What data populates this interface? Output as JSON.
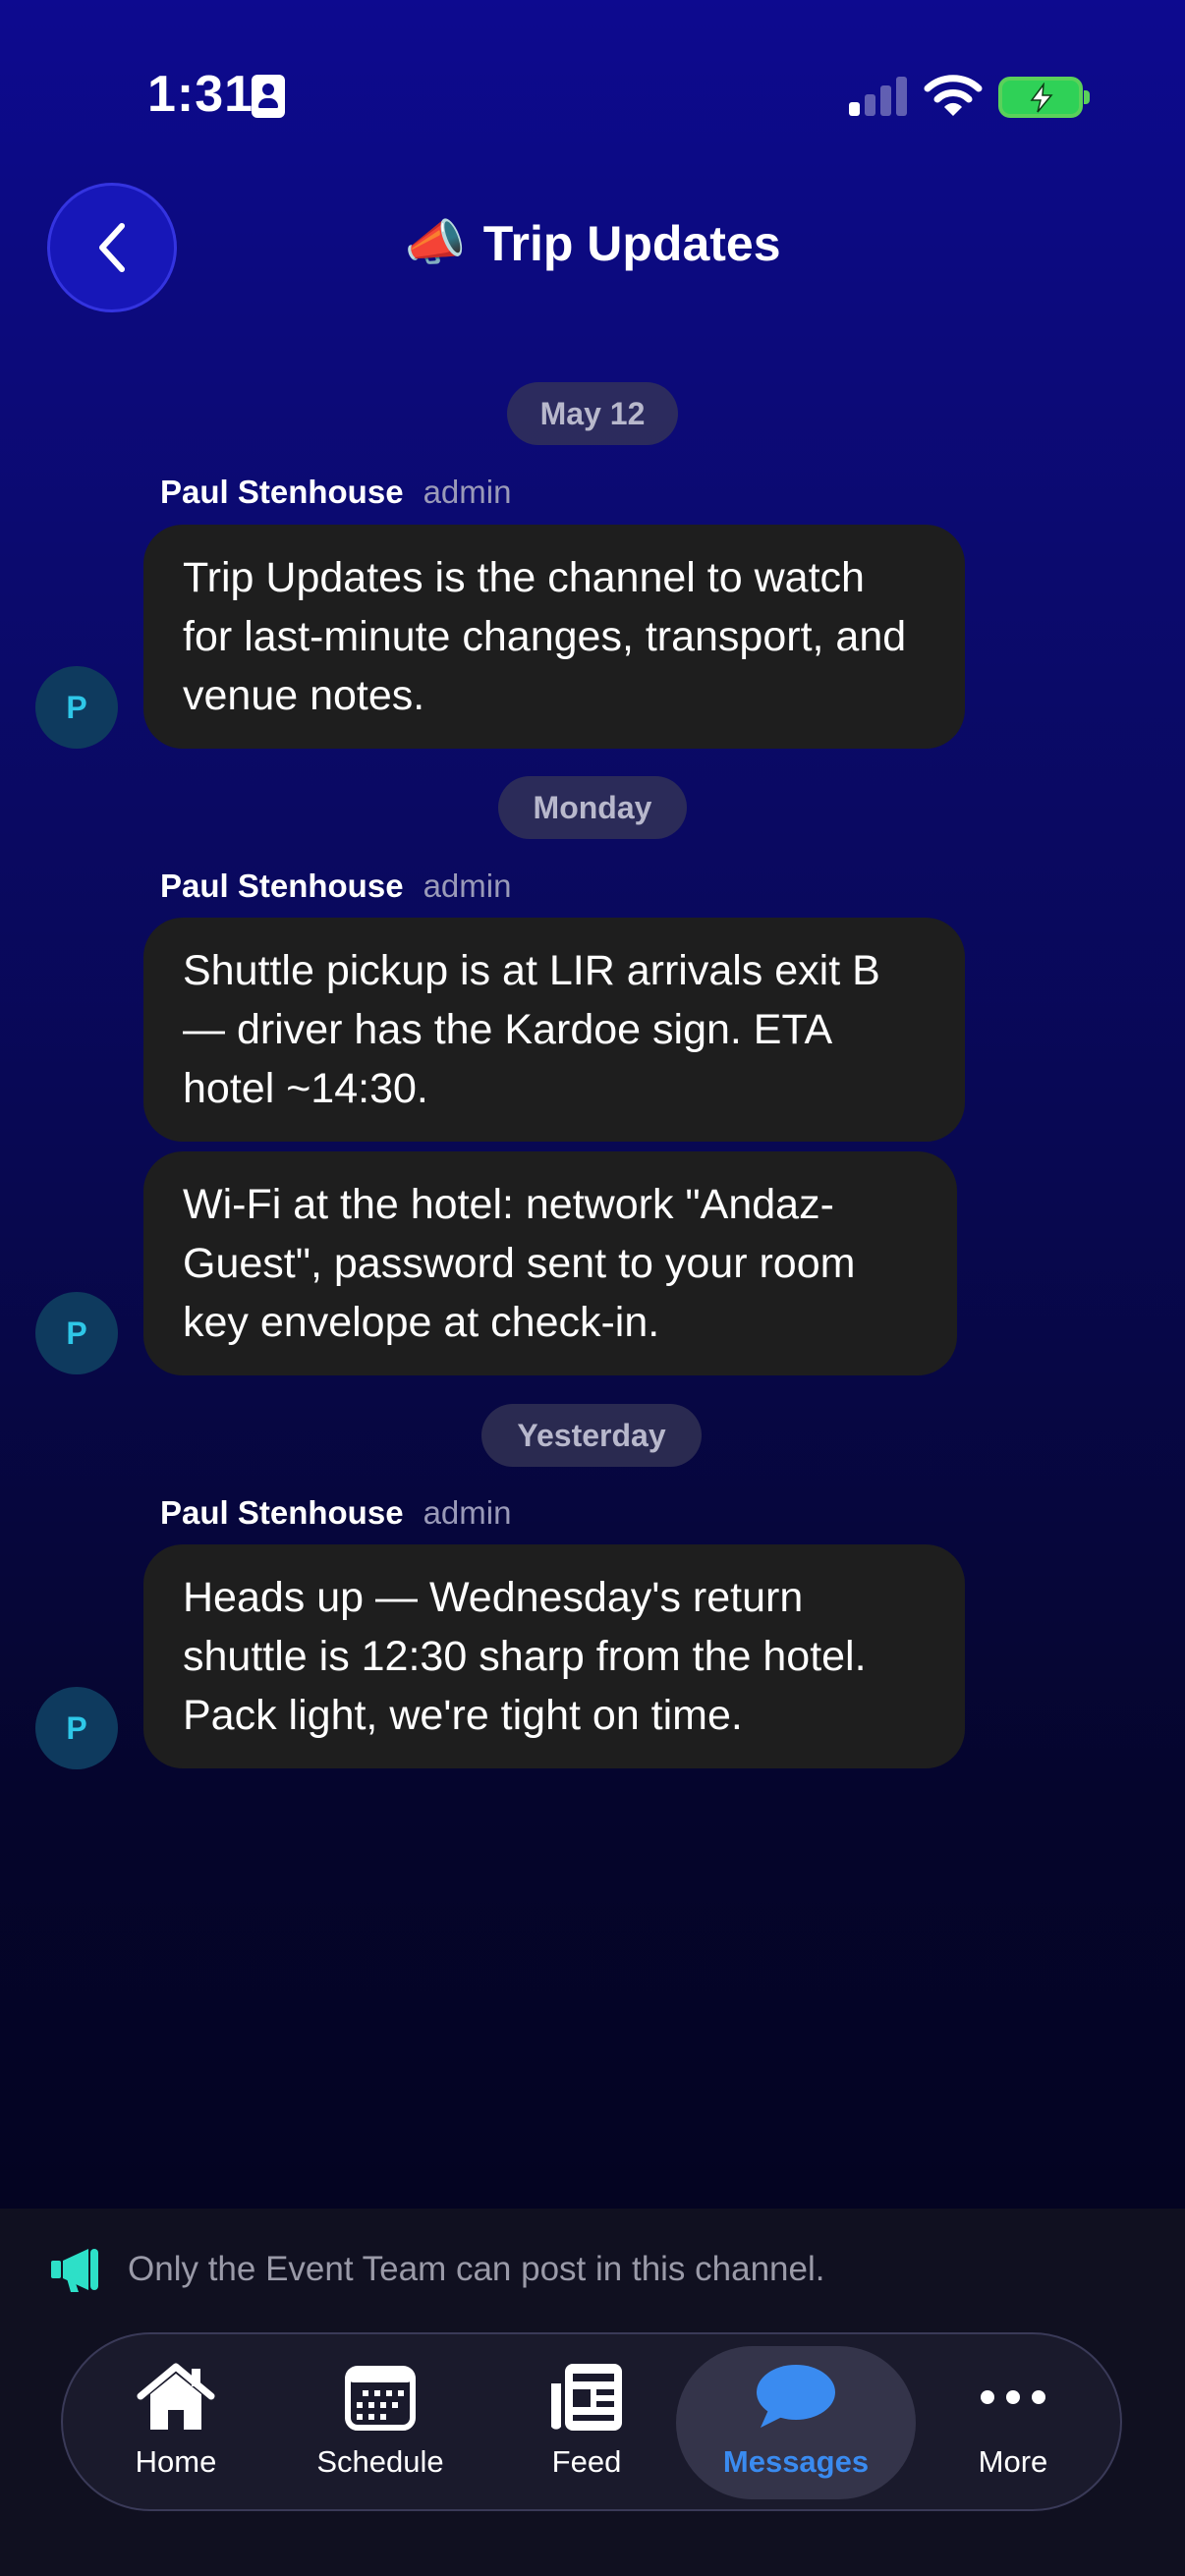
{
  "status_bar": {
    "time": "1:31"
  },
  "header": {
    "emoji": "📣",
    "title": "Trip Updates"
  },
  "messages": {
    "groups": [
      {
        "date": "May 12",
        "sender": "Paul Stenhouse",
        "role": "admin",
        "avatar": "P",
        "bubbles": [
          "Trip Updates is the channel to watch for last-minute changes, transport, and venue notes."
        ]
      },
      {
        "date": "Monday",
        "sender": "Paul Stenhouse",
        "role": "admin",
        "avatar": "P",
        "bubbles": [
          "Shuttle pickup is at LIR arrivals exit B — driver has the Kardoe sign. ETA hotel ~14:30.",
          "Wi-Fi at the hotel: network \"Andaz-Guest\", password sent to your room key envelope at check-in."
        ]
      },
      {
        "date": "Yesterday",
        "sender": "Paul Stenhouse",
        "role": "admin",
        "avatar": "P",
        "bubbles": [
          "Heads up — Wednesday's return shuttle is 12:30 sharp from the hotel. Pack light, we're tight on time."
        ]
      }
    ]
  },
  "notice": {
    "text": "Only the Event Team can post in this channel."
  },
  "tabs": [
    {
      "label": "Home",
      "icon": "home-icon"
    },
    {
      "label": "Schedule",
      "icon": "calendar-icon"
    },
    {
      "label": "Feed",
      "icon": "newspaper-icon"
    },
    {
      "label": "Messages",
      "icon": "chat-bubble-icon",
      "active": true
    },
    {
      "label": "More",
      "icon": "more-icon"
    }
  ],
  "colors": {
    "accent": "#3a8bf0",
    "notice_icon": "#2de0c8",
    "avatar_text": "#2ec7e8",
    "battery": "#2fd157"
  }
}
